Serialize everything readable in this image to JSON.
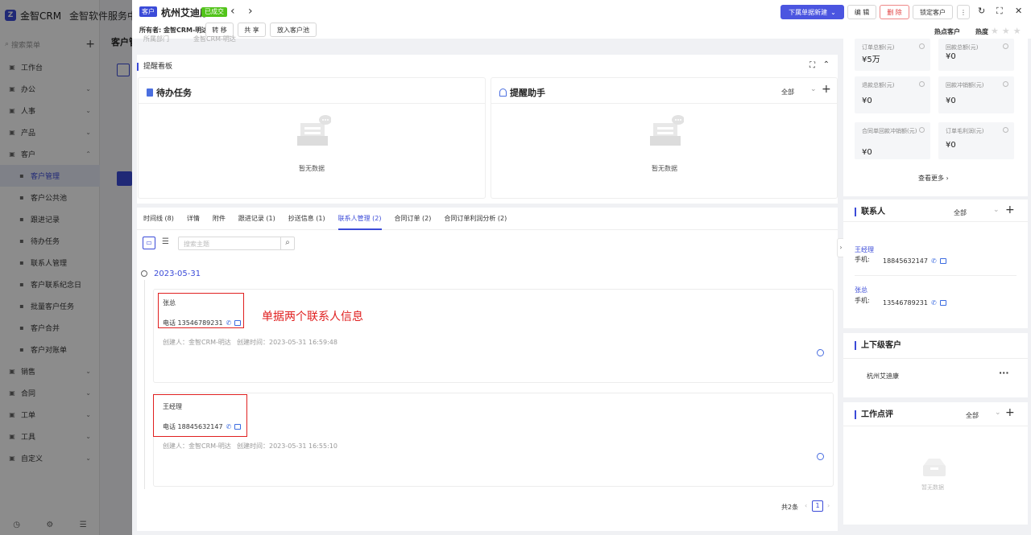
{
  "app": {
    "logo_text": "金智CRM",
    "title": "金智软件服务中心",
    "side_search_placeholder": "搜索菜单"
  },
  "sidebar": {
    "items": [
      {
        "label": "工作台",
        "icon": "home-icon",
        "has_arrow": false
      },
      {
        "label": "办公",
        "icon": "office-icon",
        "has_arrow": true
      },
      {
        "label": "人事",
        "icon": "people-icon",
        "has_arrow": true
      },
      {
        "label": "产品",
        "icon": "product-icon",
        "has_arrow": true
      },
      {
        "label": "客户",
        "icon": "customer-icon",
        "has_arrow": true,
        "expanded": true
      },
      {
        "label": "客户管理",
        "sub": true,
        "active": true
      },
      {
        "label": "客户公共池",
        "sub": true
      },
      {
        "label": "跟进记录",
        "sub": true
      },
      {
        "label": "待办任务",
        "sub": true
      },
      {
        "label": "联系人管理",
        "sub": true
      },
      {
        "label": "客户联系纪念日",
        "sub": true
      },
      {
        "label": "批量客户任务",
        "sub": true
      },
      {
        "label": "客户合并",
        "sub": true
      },
      {
        "label": "客户对账单",
        "sub": true
      },
      {
        "label": "销售",
        "icon": "sales-icon",
        "has_arrow": true
      },
      {
        "label": "合同",
        "icon": "contract-icon",
        "has_arrow": true
      },
      {
        "label": "工单",
        "icon": "ticket-icon",
        "has_arrow": true
      },
      {
        "label": "工具",
        "icon": "tool-icon",
        "has_arrow": true
      },
      {
        "label": "自定义",
        "icon": "custom-icon",
        "has_arrow": true
      }
    ],
    "bg_page_title": "客户管"
  },
  "header": {
    "type_tag": "客户",
    "customer_name": "杭州艾迪康",
    "status_tag": "已成交",
    "owner_label": "所有者:",
    "owner_value": "金智CRM-明达",
    "btn_transfer": "转 移",
    "btn_share": "共 享",
    "btn_pool": "放入客户池",
    "btn_create": "下属单据新建",
    "btn_edit": "编 辑",
    "btn_delete": "删 除",
    "btn_lock": "锁定客户",
    "hot_label": "热点客户",
    "heat_label": "热度",
    "faded_left": "所属部门",
    "faded_value": "金智CRM-明达"
  },
  "reminder_board": {
    "title": "提醒看板",
    "todo": {
      "title": "待办任务",
      "empty": "暂无数据"
    },
    "assistant": {
      "title": "提醒助手",
      "filter": "全部",
      "empty": "暂无数据"
    }
  },
  "tabs": [
    {
      "label": "时间线 (8)"
    },
    {
      "label": "详情"
    },
    {
      "label": "附件"
    },
    {
      "label": "跟进记录 (1)"
    },
    {
      "label": "抄送信息 (1)"
    },
    {
      "label": "联系人管理 (2)",
      "active": true
    },
    {
      "label": "合同订单 (2)"
    },
    {
      "label": "合同订单利润分析 (2)"
    }
  ],
  "contacts_panel": {
    "search_placeholder": "搜索主题",
    "date": "2023-05-31",
    "cards": [
      {
        "name": "张总",
        "phone": "电话 13546789231",
        "creator": "创建人：金智CRM-明达",
        "created": "创建时间：2023-05-31 16:59:48"
      },
      {
        "name": "王经理",
        "phone": "电话 18845632147",
        "creator": "创建人：金智CRM-明达",
        "created": "创建时间：2023-05-31 16:55:10"
      }
    ],
    "annotation": "单据两个联系人信息",
    "total": "共2条",
    "page": "1"
  },
  "right": {
    "stats": [
      {
        "label": "订单总额(元)",
        "value": "¥5万"
      },
      {
        "label": "回款总额(元)",
        "value": "¥0"
      },
      {
        "label": "退款总额(元)",
        "value": "¥0"
      },
      {
        "label": "回款冲销额(元)",
        "value": "¥0"
      },
      {
        "label": "合同单回款冲销额(元)",
        "value": "¥0"
      },
      {
        "label": "订单毛利润(元)",
        "value": "¥0"
      }
    ],
    "see_more": "查看更多",
    "contacts": {
      "title": "联系人",
      "filter": "全部",
      "items": [
        {
          "name": "王经理",
          "mobile_label": "手机:",
          "mobile": "18845632147"
        },
        {
          "name": "张总",
          "mobile_label": "手机:",
          "mobile": "13546789231"
        }
      ]
    },
    "parent": {
      "title": "上下级客户",
      "item": "杭州艾迪康"
    },
    "review": {
      "title": "工作点评",
      "filter": "全部",
      "empty": "暂无数据"
    }
  }
}
